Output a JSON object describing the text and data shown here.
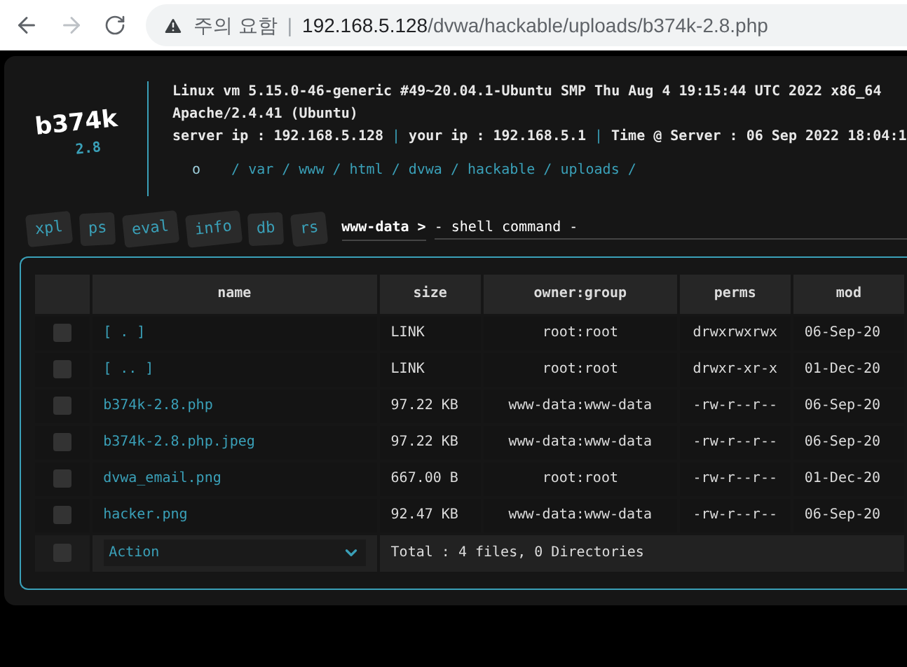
{
  "browser": {
    "security_label": "주의 요함",
    "divider": "|",
    "url_host": "192.168.5.128",
    "url_path": "/dvwa/hackable/uploads/b374k-2.8.php"
  },
  "logo": {
    "name": "b374k",
    "version": "2.8"
  },
  "info": {
    "kernel": "Linux vm 5.15.0-46-generic #49~20.04.1-Ubuntu SMP Thu Aug 4 19:15:44 UTC 2022 x86_64",
    "software": "Apache/2.4.41 (Ubuntu)",
    "server_line": [
      {
        "kind": "text",
        "text": "server ip : 192.168.5.128"
      },
      {
        "kind": "separator",
        "text": "|"
      },
      {
        "kind": "text",
        "text": "your ip : 192.168.5.1"
      },
      {
        "kind": "separator",
        "text": "|"
      },
      {
        "kind": "text",
        "text": "Time @ Server : 06 Sep 2022 18:04:1"
      }
    ]
  },
  "path": [
    {
      "kind": "home",
      "text": "o"
    },
    {
      "kind": "separator",
      "text": "/"
    },
    {
      "kind": "dir",
      "text": "var"
    },
    {
      "kind": "separator",
      "text": "/"
    },
    {
      "kind": "dir",
      "text": "www"
    },
    {
      "kind": "separator",
      "text": "/"
    },
    {
      "kind": "dir",
      "text": "html"
    },
    {
      "kind": "separator",
      "text": "/"
    },
    {
      "kind": "dir",
      "text": "dvwa"
    },
    {
      "kind": "separator",
      "text": "/"
    },
    {
      "kind": "dir",
      "text": "hackable"
    },
    {
      "kind": "separator",
      "text": "/"
    },
    {
      "kind": "dir",
      "text": "uploads"
    },
    {
      "kind": "separator",
      "text": "/"
    }
  ],
  "tabs": [
    "xpl",
    "ps",
    "eval",
    "info",
    "db",
    "rs"
  ],
  "prompt": {
    "user": "www-data >",
    "placeholder": "- shell command -"
  },
  "table": {
    "columns": [
      "name",
      "size",
      "owner:group",
      "perms",
      "mod"
    ],
    "rows": [
      {
        "checked": false,
        "name": "[ . ]",
        "size": "LINK",
        "owner": "root:root",
        "perms": "drwxrwxrwx",
        "modified": "06-Sep-20"
      },
      {
        "checked": false,
        "name": "[ .. ]",
        "size": "LINK",
        "owner": "root:root",
        "perms": "drwxr-xr-x",
        "modified": "01-Dec-20"
      },
      {
        "checked": false,
        "name": "b374k-2.8.php",
        "size": "97.22 KB",
        "owner": "www-data:www-data",
        "perms": "-rw-r--r--",
        "modified": "06-Sep-20"
      },
      {
        "checked": false,
        "name": "b374k-2.8.php.jpeg",
        "size": "97.22 KB",
        "owner": "www-data:www-data",
        "perms": "-rw-r--r--",
        "modified": "06-Sep-20"
      },
      {
        "checked": false,
        "name": "dvwa_email.png",
        "size": "667.00 B",
        "owner": "root:root",
        "perms": "-rw-r--r--",
        "modified": "01-Dec-20"
      },
      {
        "checked": false,
        "name": "hacker.png",
        "size": "92.47 KB",
        "owner": "www-data:www-data",
        "perms": "-rw-r--r--",
        "modified": "06-Sep-20"
      }
    ],
    "footer": {
      "checked": false,
      "action": "Action",
      "total": "Total : 4 files, 0 Directories"
    }
  }
}
